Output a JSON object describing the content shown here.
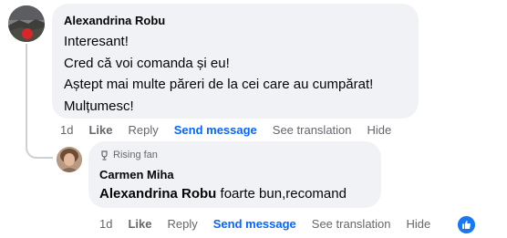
{
  "comment": {
    "author": "Alexandrina Robu",
    "lines": [
      "Interesant!",
      "Cred că voi comanda și eu!",
      "Aștept mai multe păreri de la cei care au cumpărat!",
      "Mulțumesc!"
    ],
    "actions": {
      "time": "1d",
      "like": "Like",
      "reply": "Reply",
      "send_message": "Send message",
      "see_translation": "See translation",
      "hide": "Hide"
    }
  },
  "reply": {
    "badge": "Rising fan",
    "author": "Carmen Miha",
    "mention": "Alexandrina Robu",
    "text": " foarte bun,recomand",
    "actions": {
      "time": "1d",
      "like": "Like",
      "reply": "Reply",
      "send_message": "Send message",
      "see_translation": "See translation",
      "hide": "Hide"
    },
    "reaction_icon": "thumbs-up-icon"
  },
  "colors": {
    "bubble": "#f0f2f5",
    "accent": "#0866ff",
    "secondary_text": "#65676b"
  }
}
